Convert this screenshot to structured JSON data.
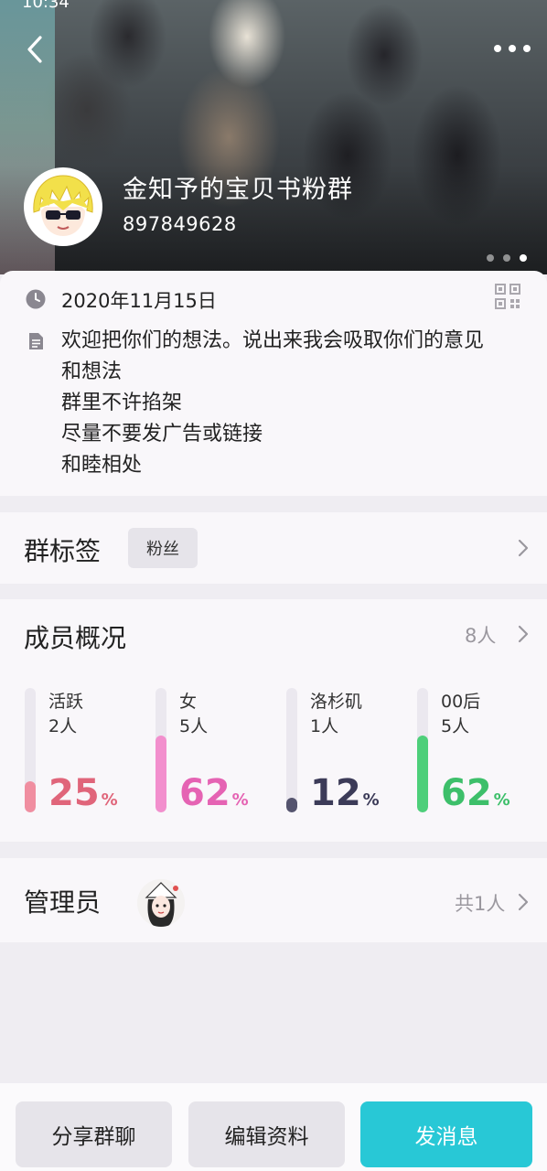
{
  "status_bar": {
    "time": "10:34"
  },
  "header": {
    "group_name": "金知予的宝贝书粉群",
    "group_id": "897849628",
    "carousel_index": 3,
    "carousel_count": 3
  },
  "info": {
    "date": "2020年11月15日",
    "description": [
      "欢迎把你们的想法。说出来我会吸取你们的意见",
      "和想法",
      "群里不许掐架",
      "尽量不要发广告或链接",
      "和睦相处"
    ]
  },
  "tags": {
    "title": "群标签",
    "items": [
      "粉丝"
    ]
  },
  "members": {
    "title": "成员概况",
    "count": "8人",
    "stats": [
      {
        "label": "活跃",
        "count": "2人",
        "value": "25",
        "unit": "%",
        "ratio": 0.25,
        "color": "#e0657a",
        "fill_color": "#f08ea0"
      },
      {
        "label": "女",
        "count": "5人",
        "value": "62",
        "unit": "%",
        "ratio": 0.62,
        "color": "#e563b3",
        "fill_color": "#f28fcd"
      },
      {
        "label": "洛杉矶",
        "count": "1人",
        "value": "12",
        "unit": "%",
        "ratio": 0.12,
        "color": "#3c3b58",
        "fill_color": "#55546e"
      },
      {
        "label": "00后",
        "count": "5人",
        "value": "62",
        "unit": "%",
        "ratio": 0.62,
        "color": "#3dbf6a",
        "fill_color": "#4ecf7a"
      }
    ]
  },
  "admin": {
    "title": "管理员",
    "count": "共1人"
  },
  "actions": {
    "share": "分享群聊",
    "edit": "编辑资料",
    "message": "发消息"
  }
}
